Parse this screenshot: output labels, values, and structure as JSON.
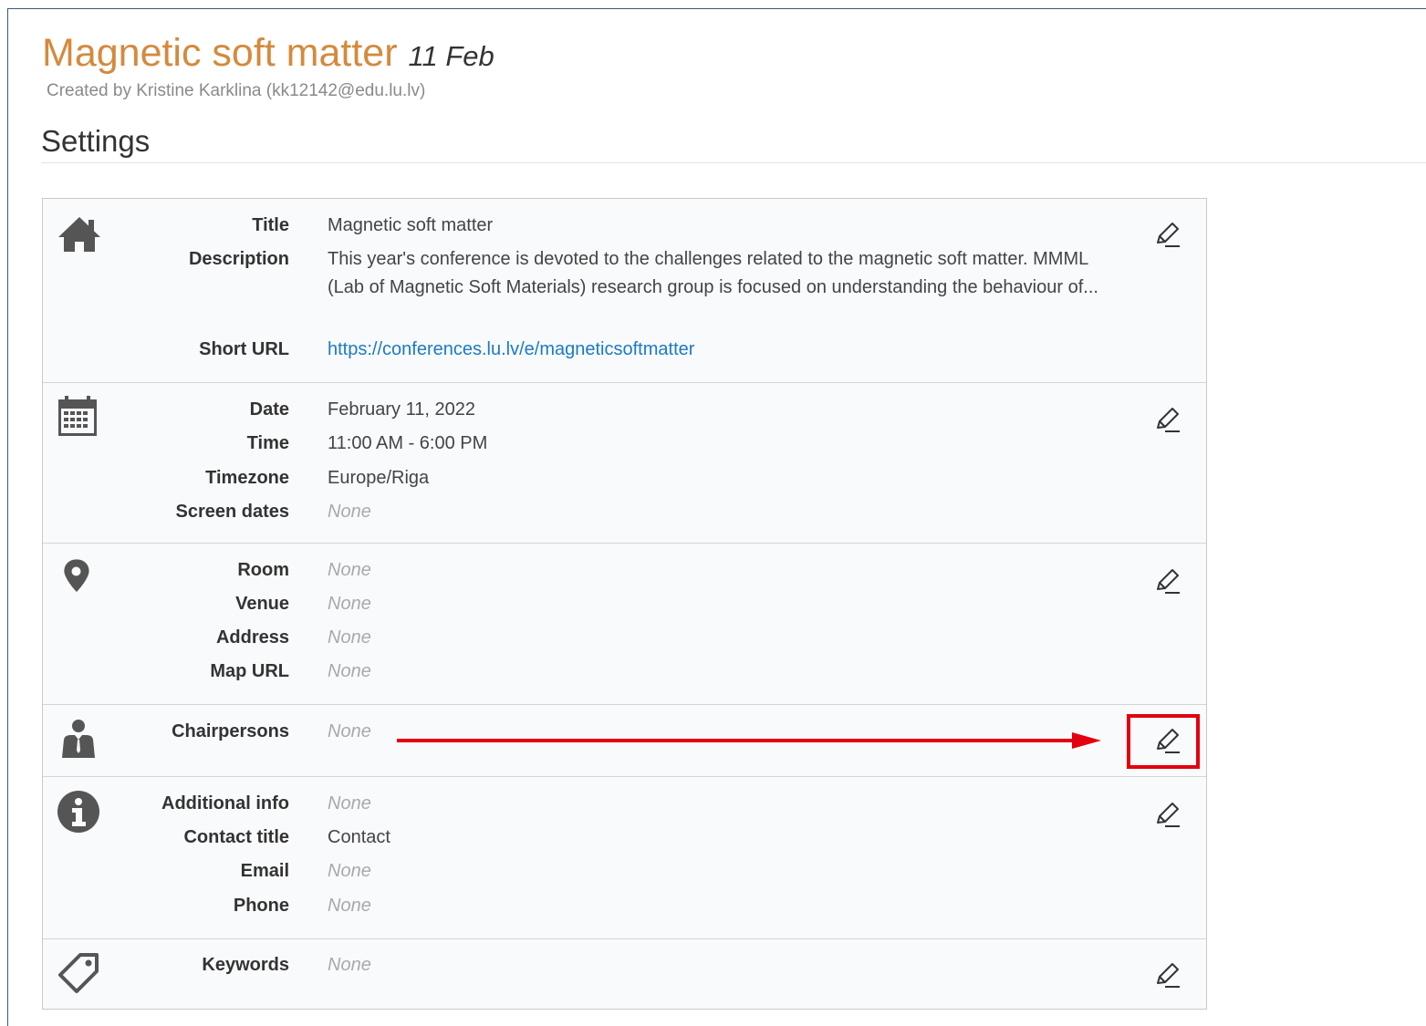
{
  "header": {
    "title": "Magnetic soft matter",
    "date": "11 Feb",
    "created_by": "Created by Kristine Karklina (kk12142@edu.lu.lv)"
  },
  "page": {
    "section_title": "Settings"
  },
  "general": {
    "icon": "home-icon",
    "title_label": "Title",
    "title_value": "Magnetic soft matter",
    "description_label": "Description",
    "description_value": "This year's conference is devoted to the challenges related to the magnetic soft matter. MMML (Lab of Magnetic Soft Materials) research group is focused on understanding the behaviour of...",
    "short_url_label": "Short URL",
    "short_url_value": "https://conferences.lu.lv/e/magneticsoftmatter"
  },
  "datetime": {
    "icon": "calendar-icon",
    "date_label": "Date",
    "date_value": "February 11, 2022",
    "time_label": "Time",
    "time_value": "11:00 AM - 6:00 PM",
    "timezone_label": "Timezone",
    "timezone_value": "Europe/Riga",
    "screen_dates_label": "Screen dates",
    "screen_dates_value": "None"
  },
  "location": {
    "icon": "location-pin-icon",
    "room_label": "Room",
    "room_value": "None",
    "venue_label": "Venue",
    "venue_value": "None",
    "address_label": "Address",
    "address_value": "None",
    "map_url_label": "Map URL",
    "map_url_value": "None"
  },
  "people": {
    "icon": "person-icon",
    "chairpersons_label": "Chairpersons",
    "chairpersons_value": "None"
  },
  "contact": {
    "icon": "info-icon",
    "additional_info_label": "Additional info",
    "additional_info_value": "None",
    "contact_title_label": "Contact title",
    "contact_title_value": "Contact",
    "email_label": "Email",
    "email_value": "None",
    "phone_label": "Phone",
    "phone_value": "None"
  },
  "keywords": {
    "icon": "tag-icon",
    "keywords_label": "Keywords",
    "keywords_value": "None"
  },
  "colors": {
    "title": "#d48a3d",
    "link": "#1a7bc4",
    "annotation": "#e3000f",
    "none_value": "#a9a9a9"
  }
}
